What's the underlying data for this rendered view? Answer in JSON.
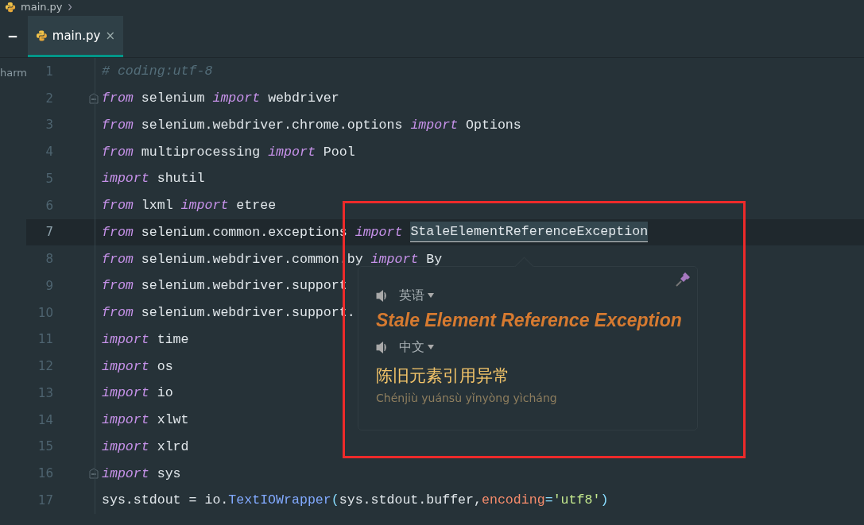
{
  "breadcrumb": {
    "label": "main.py"
  },
  "tabs": [
    {
      "label": "main.py",
      "close": "×",
      "selected": true
    }
  ],
  "project_strip": {
    "label": "harm"
  },
  "editor": {
    "lines": [
      {
        "number": "1",
        "fold": false,
        "current": false,
        "tokens": [
          {
            "text": "# coding:utf-8",
            "kind": "comment"
          }
        ]
      },
      {
        "number": "2",
        "fold": true,
        "current": false,
        "tokens": [
          {
            "text": "from",
            "kind": "keyword"
          },
          {
            "text": " selenium ",
            "kind": "plain"
          },
          {
            "text": "import",
            "kind": "keyword"
          },
          {
            "text": " webdriver",
            "kind": "plain"
          }
        ]
      },
      {
        "number": "3",
        "fold": false,
        "current": false,
        "tokens": [
          {
            "text": "from",
            "kind": "keyword"
          },
          {
            "text": " selenium.webdriver.chrome.options ",
            "kind": "plain"
          },
          {
            "text": "import",
            "kind": "keyword"
          },
          {
            "text": " Options",
            "kind": "plain"
          }
        ]
      },
      {
        "number": "4",
        "fold": false,
        "current": false,
        "tokens": [
          {
            "text": "from",
            "kind": "keyword"
          },
          {
            "text": " multiprocessing ",
            "kind": "plain"
          },
          {
            "text": "import",
            "kind": "keyword"
          },
          {
            "text": " Pool",
            "kind": "plain"
          }
        ]
      },
      {
        "number": "5",
        "fold": false,
        "current": false,
        "tokens": [
          {
            "text": "import",
            "kind": "keyword"
          },
          {
            "text": " shutil",
            "kind": "plain"
          }
        ]
      },
      {
        "number": "6",
        "fold": false,
        "current": false,
        "tokens": [
          {
            "text": "from",
            "kind": "keyword"
          },
          {
            "text": " lxml ",
            "kind": "plain"
          },
          {
            "text": "import",
            "kind": "keyword"
          },
          {
            "text": " etree",
            "kind": "plain"
          }
        ]
      },
      {
        "number": "7",
        "fold": false,
        "current": true,
        "tokens": [
          {
            "text": "from",
            "kind": "keyword"
          },
          {
            "text": " selenium.common.exceptions ",
            "kind": "plain"
          },
          {
            "text": "import",
            "kind": "keyword"
          },
          {
            "text": "StaleElementReferenceException",
            "kind": "highlight"
          }
        ]
      },
      {
        "number": "8",
        "fold": false,
        "current": false,
        "tokens": [
          {
            "text": "from",
            "kind": "keyword"
          },
          {
            "text": " selenium.webdriver.common.by ",
            "kind": "plain"
          },
          {
            "text": "import",
            "kind": "keyword"
          },
          {
            "text": " By",
            "kind": "plain"
          }
        ]
      },
      {
        "number": "9",
        "fold": false,
        "current": false,
        "tokens": [
          {
            "text": "from",
            "kind": "keyword"
          },
          {
            "text": " selenium.webdriver.support",
            "kind": "plain"
          }
        ]
      },
      {
        "number": "10",
        "fold": false,
        "current": false,
        "tokens": [
          {
            "text": "from",
            "kind": "keyword"
          },
          {
            "text": " selenium.webdriver.support.",
            "kind": "plain"
          }
        ]
      },
      {
        "number": "11",
        "fold": false,
        "current": false,
        "tokens": [
          {
            "text": "import",
            "kind": "keyword"
          },
          {
            "text": " time",
            "kind": "plain"
          }
        ]
      },
      {
        "number": "12",
        "fold": false,
        "current": false,
        "tokens": [
          {
            "text": "import",
            "kind": "keyword"
          },
          {
            "text": " os",
            "kind": "plain"
          }
        ]
      },
      {
        "number": "13",
        "fold": false,
        "current": false,
        "tokens": [
          {
            "text": "import",
            "kind": "keyword"
          },
          {
            "text": " io",
            "kind": "plain"
          }
        ]
      },
      {
        "number": "14",
        "fold": false,
        "current": false,
        "tokens": [
          {
            "text": "import",
            "kind": "keyword"
          },
          {
            "text": " xlwt",
            "kind": "plain"
          }
        ]
      },
      {
        "number": "15",
        "fold": false,
        "current": false,
        "tokens": [
          {
            "text": "import",
            "kind": "keyword"
          },
          {
            "text": " xlrd",
            "kind": "plain"
          }
        ]
      },
      {
        "number": "16",
        "fold": true,
        "current": false,
        "tokens": [
          {
            "text": "import",
            "kind": "keyword"
          },
          {
            "text": " sys",
            "kind": "plain"
          }
        ]
      },
      {
        "number": "17",
        "fold": false,
        "current": false,
        "tokens": [
          {
            "text": "sys.stdout = io.",
            "kind": "plain"
          },
          {
            "text": "TextIOWrapper",
            "kind": "function"
          },
          {
            "text": "(",
            "kind": "punct"
          },
          {
            "text": "sys.stdout.buffer,",
            "kind": "plain"
          },
          {
            "text": "encoding",
            "kind": "param"
          },
          {
            "text": "=",
            "kind": "punct"
          },
          {
            "text": "'utf8'",
            "kind": "string"
          },
          {
            "text": ")",
            "kind": "punct"
          }
        ]
      }
    ]
  },
  "translation_popup": {
    "source_language": "英语",
    "source_text": "Stale Element Reference Exception",
    "target_language": "中文",
    "translation": "陈旧元素引用异常",
    "pinyin": "Chénjiù yuánsù yǐnyòng yìcháng"
  }
}
